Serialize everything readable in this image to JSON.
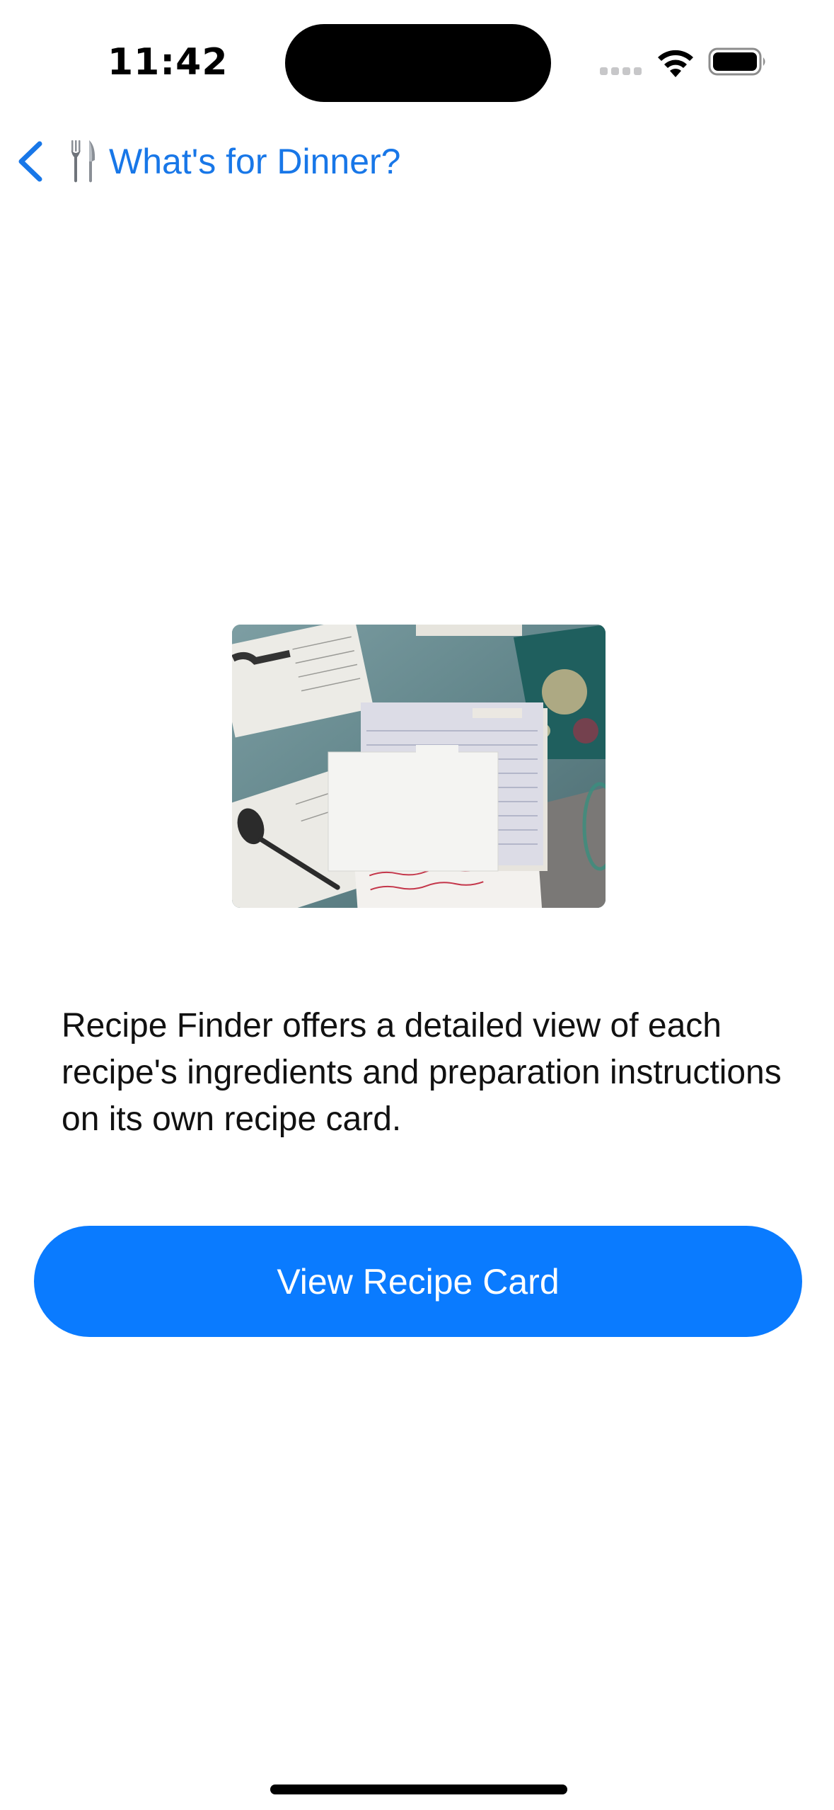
{
  "status_bar": {
    "time": "11:42"
  },
  "nav": {
    "back_icon": "chevron-left-icon",
    "title_icon": "fork-and-knife-icon",
    "title": "What's for Dinner?"
  },
  "hero": {
    "image": "recipe-cards-photo"
  },
  "content": {
    "description": "Recipe Finder offers a detailed view of each recipe's ingredients and preparation instructions on its own recipe card."
  },
  "actions": {
    "view_card_label": "View Recipe Card"
  },
  "colors": {
    "accent": "#0A7BFF",
    "link": "#1877E8",
    "background": "#FFFFFF",
    "text": "#111111"
  }
}
